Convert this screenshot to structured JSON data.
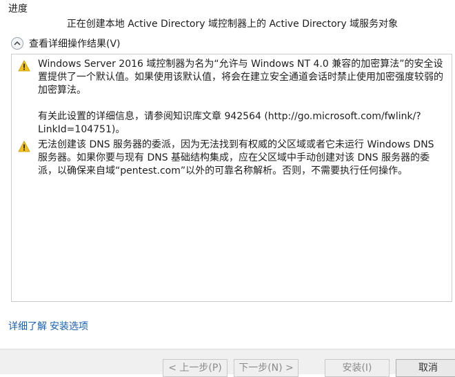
{
  "section_title": "进度",
  "status_text": "正在创建本地 Active Directory 域控制器上的 Active Directory 域服务对象",
  "details_toggle": {
    "label": "查看详细操作结果(V)",
    "icon": "chevron-up-icon"
  },
  "messages": [
    {
      "icon": "warning-icon",
      "paragraphs": [
        "Windows Server 2016 域控制器为名为“允许与 Windows NT 4.0 兼容的加密算法”的安全设置提供了一个默认值。如果使用该默认值，将会在建立安全通道会话时禁止使用加密强度较弱的加密算法。",
        "有关此设置的详细信息，请参阅知识库文章 942564 (http://go.microsoft.com/fwlink/?LinkId=104751)。"
      ]
    },
    {
      "icon": "warning-icon",
      "paragraphs": [
        "无法创建该 DNS 服务器的委派，因为无法找到有权威的父区域或者它未运行 Windows DNS 服务器。如果你要与现有 DNS 基础结构集成，应在父区域中手动创建对该 DNS 服务器的委派，以确保来自域“pentest.com”以外的可靠名称解析。否则，不需要执行任何操作。"
      ]
    }
  ],
  "links": {
    "learn_more": "详细了解",
    "install_options": "安装选项"
  },
  "buttons": {
    "back": "< 上一步(P)",
    "next": "下一步(N) >",
    "install": "安装(I)",
    "cancel": "取消"
  },
  "colors": {
    "link": "#1a5fb4",
    "warning": "#f2c21b"
  }
}
